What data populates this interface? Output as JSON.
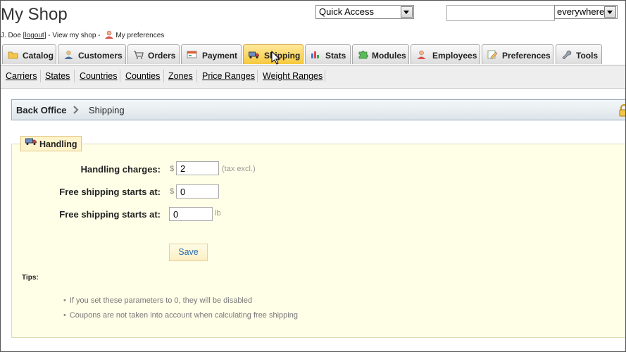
{
  "header": {
    "shop_title": "My Shop",
    "user_prefix": "J. Doe [",
    "logout": "logout",
    "user_mid": "] - ",
    "view_shop": "View my shop",
    "dash": " - ",
    "my_preferences": "My preferences",
    "quick_access": "Quick Access",
    "search_value": "",
    "search_scope": "everywhere"
  },
  "tabs": [
    {
      "label": "Catalog",
      "icon": "folder-icon"
    },
    {
      "label": "Customers",
      "icon": "user-icon"
    },
    {
      "label": "Orders",
      "icon": "cart-icon"
    },
    {
      "label": "Payment",
      "icon": "payment-icon"
    },
    {
      "label": "Shipping",
      "icon": "truck-icon",
      "active": true
    },
    {
      "label": "Stats",
      "icon": "bar-chart-icon"
    },
    {
      "label": "Modules",
      "icon": "puzzle-icon"
    },
    {
      "label": "Employees",
      "icon": "employee-icon"
    },
    {
      "label": "Preferences",
      "icon": "pencil-note-icon"
    },
    {
      "label": "Tools",
      "icon": "wrench-icon"
    }
  ],
  "subnav": [
    "Carriers",
    "States",
    "Countries",
    "Counties",
    "Zones",
    "Price Ranges",
    "Weight Ranges"
  ],
  "breadcrumb": {
    "root": "Back Office",
    "current": "Shipping"
  },
  "handling": {
    "legend": "Handling",
    "rows": [
      {
        "label": "Handling charges:",
        "currency": "$",
        "value": "2",
        "unit": "(tax excl.)"
      },
      {
        "label": "Free shipping starts at:",
        "currency": "$",
        "value": "0",
        "unit": ""
      },
      {
        "label": "Free shipping starts at:",
        "currency": "",
        "value": "0",
        "unit": "lb"
      }
    ],
    "save_label": "Save"
  },
  "tips": {
    "heading": "Tips:",
    "items": [
      "If you set these parameters to 0, they will be disabled",
      "Coupons are not taken into account when calculating free shipping"
    ]
  },
  "colors": {
    "active_tab": "#f6c93d",
    "panel_bg": "#ffffe8",
    "save_text": "#2a6fb0"
  }
}
